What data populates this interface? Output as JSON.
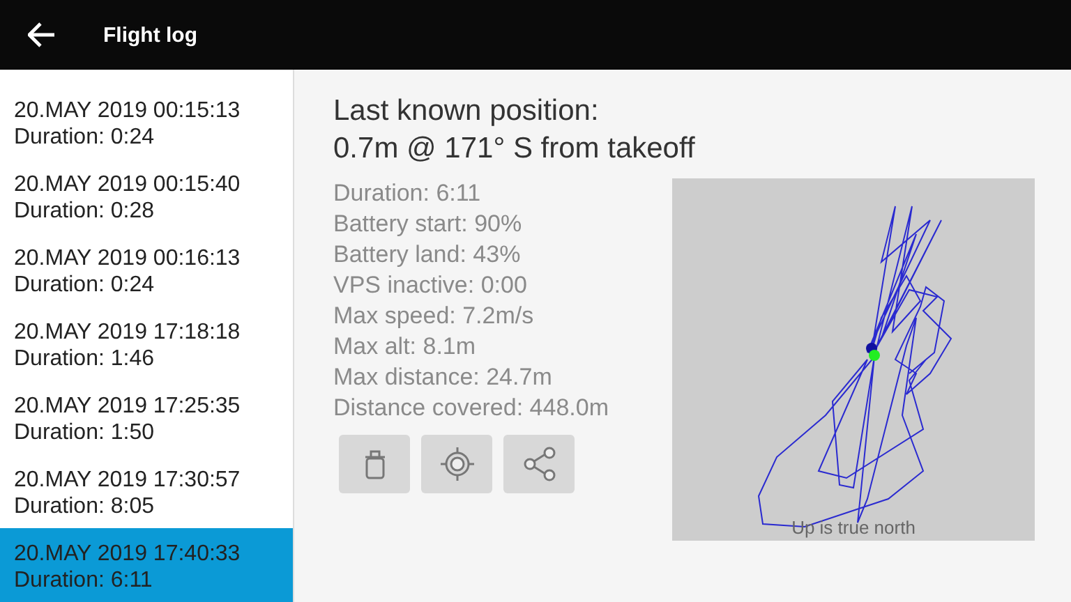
{
  "app_bar": {
    "title": "Flight log"
  },
  "flights": [
    {
      "date": "20.MAY 2019 00:15:13",
      "duration": "Duration: 0:24",
      "selected": false
    },
    {
      "date": "20.MAY 2019 00:15:40",
      "duration": "Duration: 0:28",
      "selected": false
    },
    {
      "date": "20.MAY 2019 00:16:13",
      "duration": "Duration: 0:24",
      "selected": false
    },
    {
      "date": "20.MAY 2019 17:18:18",
      "duration": "Duration: 1:46",
      "selected": false
    },
    {
      "date": "20.MAY 2019 17:25:35",
      "duration": "Duration: 1:50",
      "selected": false
    },
    {
      "date": "20.MAY 2019 17:30:57",
      "duration": "Duration: 8:05",
      "selected": false
    },
    {
      "date": "20.MAY 2019 17:40:33",
      "duration": "Duration: 6:11",
      "selected": true
    }
  ],
  "detail": {
    "title_lines": [
      "Last known position:",
      "0.7m @ 171° S from takeoff"
    ],
    "stats": [
      "Duration:  6:11",
      "Battery start: 90%",
      "Battery land: 43%",
      "VPS inactive:  0:00",
      "Max speed: 7.2m/s",
      "Max alt: 8.1m",
      "Max distance: 24.7m",
      "Distance covered: 448.0m"
    ],
    "actions": [
      {
        "kind": "delete"
      },
      {
        "kind": "locate"
      },
      {
        "kind": "share"
      }
    ],
    "map_caption": "Up is true north"
  }
}
